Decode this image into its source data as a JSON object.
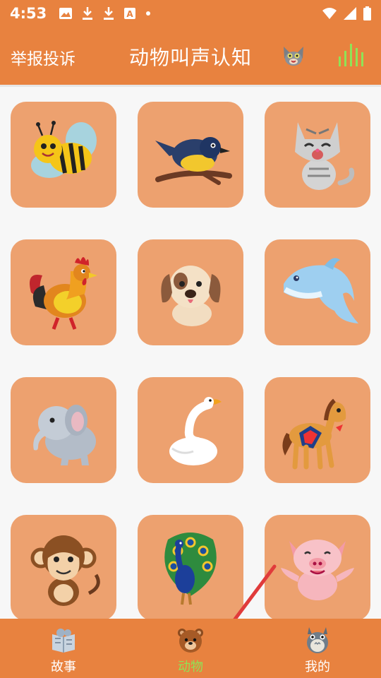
{
  "status_bar": {
    "time": "4:53",
    "icons": [
      "image-icon",
      "download-icon",
      "download-icon",
      "font-icon",
      "dot-icon"
    ],
    "right_icons": [
      "wifi-icon",
      "signal-icon",
      "battery-icon"
    ]
  },
  "header": {
    "report_label": "举报投诉",
    "title": "动物叫声认知",
    "avatar_icon": "talking-cat-icon",
    "sound_icon": "sound-bars-icon"
  },
  "animals": [
    {
      "name": "bee",
      "icon": "bee-icon"
    },
    {
      "name": "bird",
      "icon": "bird-icon"
    },
    {
      "name": "cat",
      "icon": "cat-icon"
    },
    {
      "name": "rooster",
      "icon": "rooster-icon"
    },
    {
      "name": "dog",
      "icon": "dog-icon"
    },
    {
      "name": "dolphin",
      "icon": "dolphin-icon"
    },
    {
      "name": "elephant",
      "icon": "elephant-icon"
    },
    {
      "name": "goose",
      "icon": "goose-icon"
    },
    {
      "name": "horse",
      "icon": "horse-icon"
    },
    {
      "name": "monkey",
      "icon": "monkey-icon"
    },
    {
      "name": "peacock",
      "icon": "peacock-icon"
    },
    {
      "name": "pig",
      "icon": "pig-icon"
    }
  ],
  "bottom_nav": [
    {
      "label": "故事",
      "icon": "book-icon",
      "active": false
    },
    {
      "label": "动物",
      "icon": "bear-icon",
      "active": true
    },
    {
      "label": "我的",
      "icon": "totoro-icon",
      "active": false
    }
  ],
  "colors": {
    "brand": "#e8823f",
    "tile": "#eda16f",
    "active_tab": "#8fe356",
    "annotation_arrow": "#e03b3b"
  }
}
